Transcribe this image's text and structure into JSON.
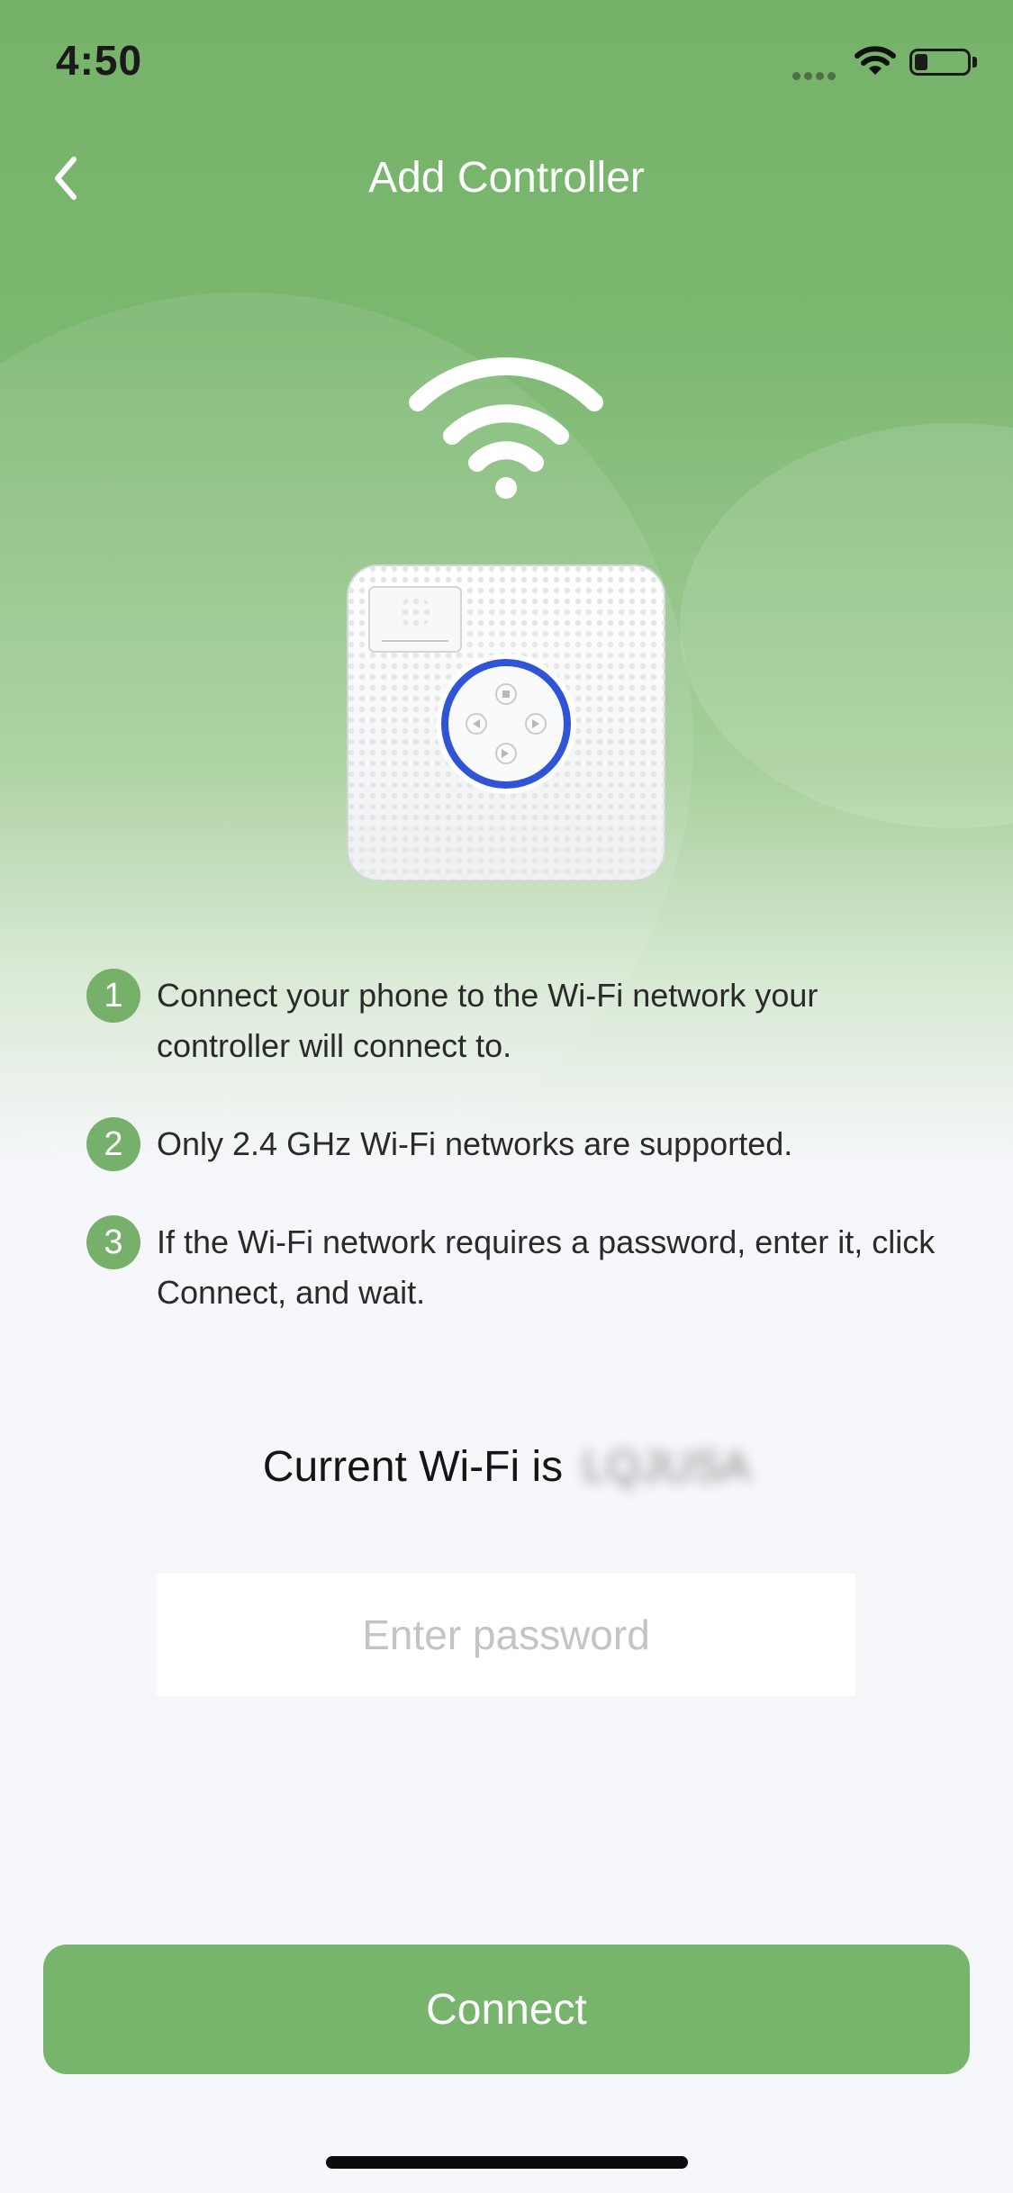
{
  "status_bar": {
    "time": "4:50"
  },
  "nav": {
    "title": "Add Controller",
    "back_icon": "chevron-left-icon"
  },
  "illustration": {
    "wifi_icon": "wifi-icon",
    "device": "controller-device-image"
  },
  "steps": [
    {
      "number": "1",
      "text": "Connect your phone to the Wi-Fi network your controller will connect to."
    },
    {
      "number": "2",
      "text": "Only 2.4 GHz Wi-Fi networks are supported."
    },
    {
      "number": "3",
      "text": "If the Wi-Fi network requires a password, enter it, click Connect, and wait."
    }
  ],
  "wifi": {
    "label": "Current Wi-Fi is",
    "ssid": "LQJUSA"
  },
  "password": {
    "placeholder": "Enter password",
    "value": ""
  },
  "connect_button": {
    "label": "Connect"
  },
  "colors": {
    "accent": "#77b56d",
    "header_green": "#76b26a",
    "background": "#f6f7fb",
    "device_ring": "#2f54d8"
  }
}
